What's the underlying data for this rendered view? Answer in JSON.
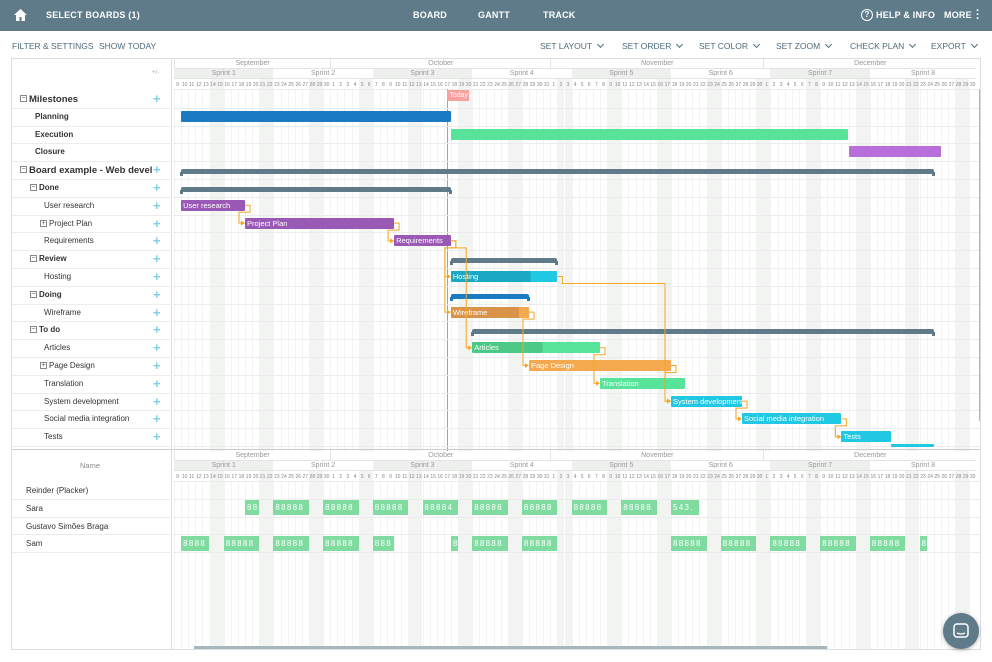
{
  "topbar": {
    "home_icon": "home-icon",
    "select_boards": "SELECT BOARDS (1)",
    "nav": [
      "BOARD",
      "GANTT",
      "TRACK"
    ],
    "help": "HELP & INFO",
    "more": "MORE"
  },
  "toolbar": {
    "filter": "FILTER & SETTINGS",
    "show_today": "SHOW TODAY",
    "menus": [
      "SET LAYOUT",
      "SET ORDER",
      "SET COLOR",
      "SET ZOOM",
      "CHECK PLAN",
      "EXPORT"
    ]
  },
  "grid": {
    "plus_minus": "+/-",
    "today_label": "Today",
    "today": "Oct 17",
    "name_header": "Name"
  },
  "timeline": {
    "start": "Sep 9",
    "end": "Dec 30",
    "months": [
      {
        "label": "September",
        "start": "Sep 9",
        "end": "Sep 30"
      },
      {
        "label": "October",
        "start": "Oct 1",
        "end": "Oct 31"
      },
      {
        "label": "November",
        "start": "Nov 1",
        "end": "Nov 30"
      },
      {
        "label": "December",
        "start": "Dec 1",
        "end": "Dec 30"
      }
    ],
    "sprints": [
      {
        "label": "Sprint 1",
        "start": "Sep 9",
        "end": "Sep 22"
      },
      {
        "label": "Sprint 2",
        "start": "Sep 23",
        "end": "Oct 6"
      },
      {
        "label": "Sprint 3",
        "start": "Oct 7",
        "end": "Oct 20"
      },
      {
        "label": "Sprint 4",
        "start": "Oct 21",
        "end": "Nov 3"
      },
      {
        "label": "Sprint 5",
        "start": "Nov 4",
        "end": "Nov 17"
      },
      {
        "label": "Sprint 6",
        "start": "Nov 18",
        "end": "Dec 1"
      },
      {
        "label": "Sprint 7",
        "start": "Dec 2",
        "end": "Dec 15"
      },
      {
        "label": "Sprint 8",
        "start": "Dec 16",
        "end": "Dec 30"
      }
    ]
  },
  "rows": [
    {
      "label": "Milestones",
      "level": 0,
      "bold": true,
      "toggle": "-",
      "plus": true,
      "summary": null
    },
    {
      "label": "Planning",
      "level": 1,
      "bold": true,
      "milestone": true,
      "bar": {
        "start": "Sep 10",
        "end": "Oct 17",
        "color": "#1a7bc4"
      }
    },
    {
      "label": "Execution",
      "level": 1,
      "bold": true,
      "milestone": true,
      "bar": {
        "start": "Oct 18",
        "end": "Dec 12",
        "color": "#57e39a"
      }
    },
    {
      "label": "Closure",
      "level": 1,
      "bold": true,
      "milestone": true,
      "bar": {
        "start": "Dec 13",
        "end": "Dec 25",
        "color": "#b86fdc"
      }
    },
    {
      "label": "Board example - Web devel",
      "level": 0,
      "bold": true,
      "toggle": "-",
      "plus": true,
      "summary": {
        "start": "Sep 10",
        "end": "Dec 24",
        "color": "#5f7b89"
      }
    },
    {
      "label": "Done",
      "level": 1,
      "bold": true,
      "toggle": "-",
      "plus": true,
      "summary": {
        "start": "Sep 10",
        "end": "Oct 17",
        "color": "#5f7b89"
      }
    },
    {
      "label": "User research",
      "level": 2,
      "plus": true,
      "bar": {
        "start": "Sep 10",
        "end": "Sep 18",
        "color": "#9b59b6",
        "label": "User research"
      }
    },
    {
      "label": "Project Plan",
      "level": 2,
      "toggle": "+",
      "plus": true,
      "bar": {
        "start": "Sep 19",
        "end": "Oct 9",
        "color": "#9b59b6",
        "label": "Project Plan"
      }
    },
    {
      "label": "Requirements",
      "level": 2,
      "plus": true,
      "bar": {
        "start": "Oct 10",
        "end": "Oct 17",
        "color": "#9b59b6",
        "label": "Requirements"
      }
    },
    {
      "label": "Review",
      "level": 1,
      "bold": true,
      "toggle": "-",
      "plus": true,
      "summary": {
        "start": "Oct 18",
        "end": "Nov 1",
        "color": "#5f7b89"
      }
    },
    {
      "label": "Hosting",
      "level": 2,
      "plus": true,
      "bar": {
        "start": "Oct 18",
        "end": "Nov 1",
        "color": "#1aa9c4",
        "light": "#21c8e4",
        "progress": 0.75,
        "label": "Hosting"
      }
    },
    {
      "label": "Doing",
      "level": 1,
      "bold": true,
      "toggle": "-",
      "plus": true,
      "summary": {
        "start": "Oct 18",
        "end": "Oct 28",
        "color": "#1a7bc4"
      }
    },
    {
      "label": "Wireframe",
      "level": 2,
      "plus": true,
      "bar": {
        "start": "Oct 18",
        "end": "Oct 28",
        "color": "#d9944a",
        "light": "#f5a94e",
        "progress": 0.87,
        "label": "Wireframe"
      }
    },
    {
      "label": "To do",
      "level": 1,
      "bold": true,
      "toggle": "-",
      "plus": true,
      "summary": {
        "start": "Oct 21",
        "end": "Dec 24",
        "color": "#5f7b89"
      }
    },
    {
      "label": "Articles",
      "level": 2,
      "plus": true,
      "bar": {
        "start": "Oct 21",
        "end": "Nov 7",
        "color": "#4cc887",
        "light": "#57e39a",
        "progress": 0.55,
        "label": "Articles"
      }
    },
    {
      "label": "Page Design",
      "level": 2,
      "toggle": "+",
      "plus": true,
      "bar": {
        "start": "Oct 29",
        "end": "Nov 17",
        "color": "#f5a94e",
        "label": "Page Design"
      }
    },
    {
      "label": "Translation",
      "level": 2,
      "plus": true,
      "bar": {
        "start": "Nov 8",
        "end": "Nov 19",
        "color": "#57e39a",
        "label": "Translation"
      }
    },
    {
      "label": "System development",
      "level": 2,
      "plus": true,
      "bar": {
        "start": "Nov 18",
        "end": "Nov 27",
        "color": "#21c8e4",
        "label": "System development"
      }
    },
    {
      "label": "Social media integration",
      "level": 2,
      "plus": true,
      "bar": {
        "start": "Nov 28",
        "end": "Dec 11",
        "color": "#21c8e4",
        "label": "Social media integration"
      }
    },
    {
      "label": "Tests",
      "level": 2,
      "plus": true,
      "bar": {
        "start": "Dec 12",
        "end": "Dec 18",
        "color": "#21c8e4",
        "label": "Tests"
      }
    }
  ],
  "dependencies": [
    [
      "User research",
      "Project Plan"
    ],
    [
      "Project Plan",
      "Requirements"
    ],
    [
      "Requirements",
      "Hosting"
    ],
    [
      "Requirements",
      "Wireframe"
    ],
    [
      "Requirements",
      "Articles"
    ],
    [
      "Wireframe",
      "Page Design"
    ],
    [
      "Articles",
      "Translation"
    ],
    [
      "Hosting",
      "System development"
    ],
    [
      "Page Design",
      "System development"
    ],
    [
      "System development",
      "Social media integration"
    ],
    [
      "Social media integration",
      "Tests"
    ]
  ],
  "resources": [
    {
      "name": "Reinder (Placker)",
      "loads": []
    },
    {
      "name": "Sara",
      "loads": [
        {
          "start": "Sep 19",
          "hours": "88"
        },
        {
          "start": "Sep 23",
          "hours": "88888"
        },
        {
          "start": "Sep 30",
          "hours": "88888"
        },
        {
          "start": "Oct 7",
          "hours": "88888"
        },
        {
          "start": "Oct 14",
          "hours": "88884"
        },
        {
          "start": "Oct 21",
          "hours": "88888"
        },
        {
          "start": "Oct 28",
          "hours": "88888"
        },
        {
          "start": "Nov 4",
          "hours": "88888"
        },
        {
          "start": "Nov 11",
          "hours": "88888"
        },
        {
          "start": "Nov 18",
          "hours": "543."
        }
      ]
    },
    {
      "name": "Gustavo Simões Braga",
      "loads": []
    },
    {
      "name": "Sam",
      "loads": [
        {
          "start": "Sep 10",
          "hours": "8888"
        },
        {
          "start": "Sep 16",
          "hours": "88888"
        },
        {
          "start": "Sep 23",
          "hours": "88888"
        },
        {
          "start": "Sep 30",
          "hours": "88888"
        },
        {
          "start": "Oct 7",
          "hours": "888"
        },
        {
          "start": "Oct 18",
          "hours": "8"
        },
        {
          "start": "Oct 21",
          "hours": "88888"
        },
        {
          "start": "Oct 28",
          "hours": "88888"
        },
        {
          "start": "Nov 18",
          "hours": "88888"
        },
        {
          "start": "Nov 25",
          "hours": "88888"
        },
        {
          "start": "Dec 2",
          "hours": "88888"
        },
        {
          "start": "Dec 9",
          "hours": "88888"
        },
        {
          "start": "Dec 16",
          "hours": "88888"
        },
        {
          "start": "Dec 23",
          "hours": "8"
        }
      ]
    }
  ],
  "colors": {
    "topbar": "#5f7b89",
    "today": "#f08080",
    "dependency": "#f5a623",
    "plus": "#7fd0e6"
  }
}
